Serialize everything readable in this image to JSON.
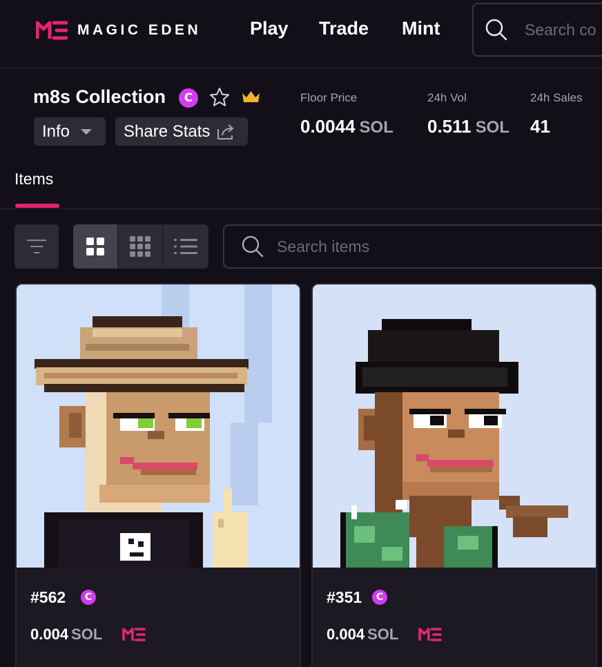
{
  "nav": {
    "brand": "MAGIC EDEN",
    "links": [
      "Play",
      "Trade",
      "Mint"
    ],
    "search_placeholder": "Search co"
  },
  "collection": {
    "name": "m8s Collection",
    "info_label": "Info",
    "share_label": "Share Stats",
    "stats": [
      {
        "label": "Floor Price",
        "value": "0.0044",
        "unit": "SOL"
      },
      {
        "label": "24h Vol",
        "value": "0.511",
        "unit": "SOL"
      },
      {
        "label": "24h Sales",
        "value": "41",
        "unit": ""
      }
    ]
  },
  "tabs": [
    "Items"
  ],
  "toolbar": {
    "search_placeholder": "Search items",
    "view_modes": [
      "grid-large",
      "grid-small",
      "list"
    ],
    "active_view": "grid-large"
  },
  "items": [
    {
      "name": "#562",
      "price": "0.004",
      "unit": "SOL"
    },
    {
      "name": "#351",
      "price": "0.004",
      "unit": "SOL"
    }
  ],
  "colors": {
    "background": "#120f18",
    "accent": "#e42575",
    "verified_badge": "#d13cf0",
    "surface": "#2e2b36",
    "crown": "#f0b429"
  }
}
